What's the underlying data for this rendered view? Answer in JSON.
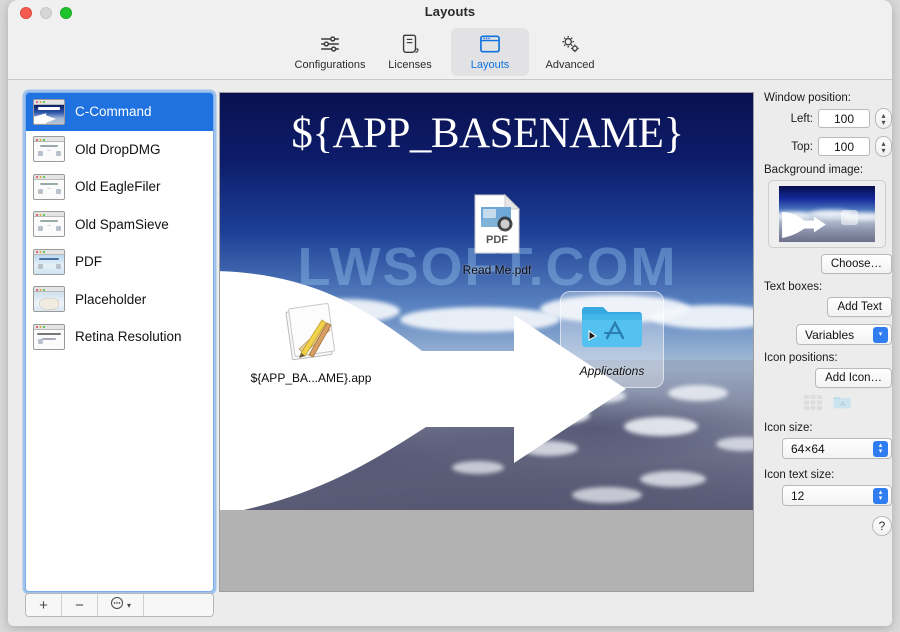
{
  "window": {
    "title": "Layouts",
    "traffic_lights": [
      "close",
      "minimize",
      "zoom"
    ]
  },
  "toolbar": {
    "items": [
      {
        "label": "Configurations",
        "icon": "sliders-icon",
        "selected": false
      },
      {
        "label": "Licenses",
        "icon": "document-scroll-icon",
        "selected": false
      },
      {
        "label": "Layouts",
        "icon": "window-icon",
        "selected": true
      },
      {
        "label": "Advanced",
        "icon": "gears-icon",
        "selected": false
      }
    ],
    "accent_color": "#1072e0"
  },
  "sidebar": {
    "items": [
      {
        "label": "C-Command",
        "thumb": "sky",
        "selected": true
      },
      {
        "label": "Old DropDMG",
        "thumb": "plain",
        "selected": false
      },
      {
        "label": "Old EagleFiler",
        "thumb": "plain",
        "selected": false
      },
      {
        "label": "Old SpamSieve",
        "thumb": "plain",
        "selected": false
      },
      {
        "label": "PDF",
        "thumb": "pdf",
        "selected": false
      },
      {
        "label": "Placeholder",
        "thumb": "ph",
        "selected": false
      },
      {
        "label": "Retina Resolution",
        "thumb": "ret",
        "selected": false
      }
    ],
    "toolbar": {
      "add_label": "+",
      "remove_label": "−",
      "action_label": "⋯",
      "action_chevron": "⌄"
    },
    "selection_color": "#1f72e0"
  },
  "canvas": {
    "banner_text": "${APP_BASENAME}",
    "watermark": "LWSOFT.COM",
    "icons": [
      {
        "name": "readme-pdf",
        "label": "Read Me.pdf",
        "badge": "PDF",
        "selected": false
      },
      {
        "name": "app-bundle",
        "label": "${APP_BA...AME}.app",
        "selected": false
      },
      {
        "name": "applications",
        "label": "Applications",
        "selected": true
      }
    ]
  },
  "inspector": {
    "window_position_label": "Window position:",
    "left_label": "Left:",
    "left_value": "100",
    "top_label": "Top:",
    "top_value": "100",
    "background_image_label": "Background image:",
    "choose_label": "Choose…",
    "text_boxes_label": "Text boxes:",
    "add_text_label": "Add Text",
    "variables_label": "Variables",
    "icon_positions_label": "Icon positions:",
    "add_icon_label": "Add Icon…",
    "icon_size_label": "Icon size:",
    "icon_size_value": "64×64",
    "icon_text_size_label": "Icon text size:",
    "icon_text_size_value": "12",
    "help_label": "?"
  }
}
